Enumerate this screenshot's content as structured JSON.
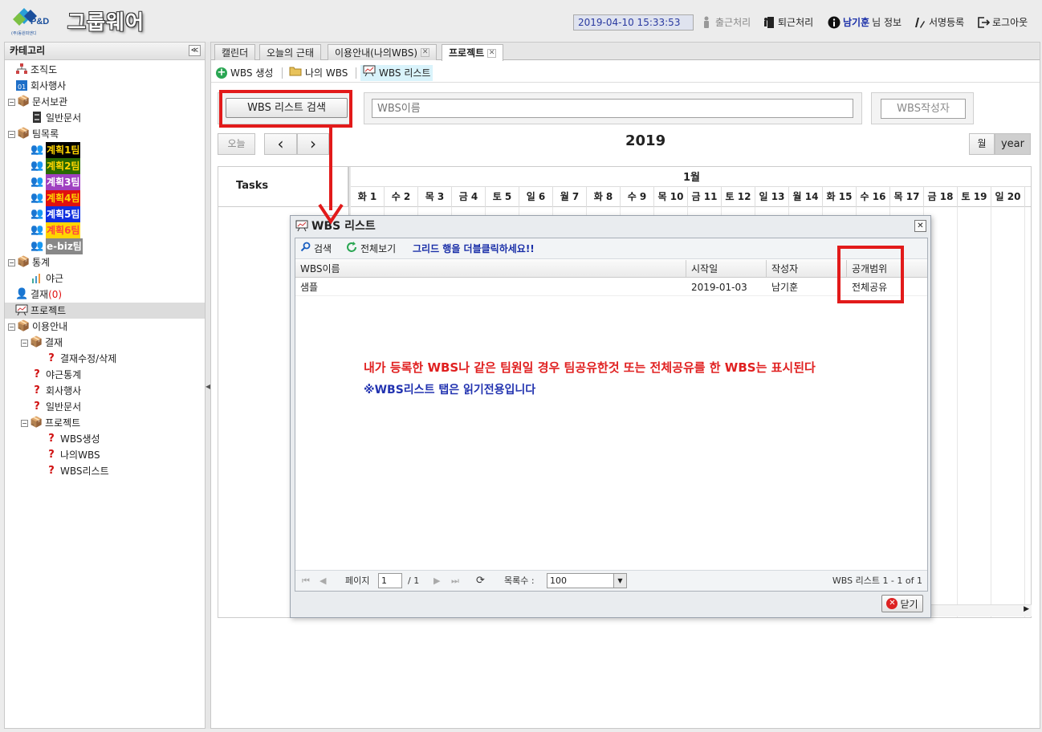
{
  "header": {
    "brand": "그룹웨어",
    "logo_text": "P&D",
    "logo_sub": "(주)동원피앤디",
    "datetime": "2019-04-10 15:33:53",
    "nav": [
      {
        "label": "출근처리",
        "icon": "person-icon"
      },
      {
        "label": "퇴근처리",
        "icon": "exit-door-icon"
      },
      {
        "label": "님 정보",
        "user": "남기훈",
        "icon": "info-icon"
      },
      {
        "label": "서명등록",
        "icon": "pen-icon"
      },
      {
        "label": "로그아웃",
        "icon": "logout-icon"
      }
    ]
  },
  "sidebar": {
    "title": "카테고리",
    "collapse": "≪",
    "items": [
      {
        "label": "조직도"
      },
      {
        "label": "회사행사"
      },
      {
        "label": "문서보관"
      },
      {
        "label": "일반문서"
      },
      {
        "label": "팀목록"
      },
      {
        "label": "계획1팀",
        "fg": "#ffd400",
        "bg": "#000000"
      },
      {
        "label": "계획2팀",
        "fg": "#ffd400",
        "bg": "#2a6a00"
      },
      {
        "label": "계획3팀",
        "fg": "#ffffff",
        "bg": "#a040c0"
      },
      {
        "label": "계획4팀",
        "fg": "#ffd400",
        "bg": "#e01010"
      },
      {
        "label": "계획5팀",
        "fg": "#ffffff",
        "bg": "#1030e0"
      },
      {
        "label": "계획6팀",
        "fg": "#ff4040",
        "bg": "#ffd400"
      },
      {
        "label": "e-biz팀",
        "fg": "#ffffff",
        "bg": "#888888"
      },
      {
        "label": "통계"
      },
      {
        "label": "야근"
      },
      {
        "label": "결재",
        "count": "(0)"
      },
      {
        "label": "프로젝트"
      },
      {
        "label": "이용안내"
      },
      {
        "label": "결재"
      },
      {
        "label": "결재수정/삭제"
      },
      {
        "label": "야근통계"
      },
      {
        "label": "회사행사"
      },
      {
        "label": "일반문서"
      },
      {
        "label": "프로젝트"
      },
      {
        "label": "WBS생성"
      },
      {
        "label": "나의WBS"
      },
      {
        "label": "WBS리스트"
      }
    ]
  },
  "tabs": [
    {
      "label": "캘린더"
    },
    {
      "label": "오늘의 근태"
    },
    {
      "label": "이용안내(나의WBS)",
      "close": "✕"
    },
    {
      "label": "프로젝트",
      "close": "✕"
    }
  ],
  "subtoolbar": {
    "create": "WBS 생성",
    "mine": "나의 WBS",
    "list": "WBS 리스트"
  },
  "search": {
    "button": "WBS 리스트 검색",
    "name_placeholder": "WBS이름",
    "writer": "WBS작성자"
  },
  "calendar": {
    "today": "오늘",
    "prev": "‹",
    "next": "›",
    "year": "2019",
    "month_view": "월",
    "year_view": "year",
    "tasks": "Tasks",
    "month": "1월",
    "days": [
      "화 1",
      "수 2",
      "목 3",
      "금 4",
      "토 5",
      "일 6",
      "월 7",
      "화 8",
      "수 9",
      "목 10",
      "금 11",
      "토 12",
      "일 13",
      "월 14",
      "화 15",
      "수 16",
      "목 17",
      "금 18",
      "토 19",
      "일 20"
    ]
  },
  "dialog": {
    "title": "WBS 리스트",
    "close_x": "✕",
    "search": "검색",
    "view_all": "전체보기",
    "hint": "그리드 행을 더블클릭하세요!!",
    "columns": [
      "WBS이름",
      "시작일",
      "작성자",
      "공개범위"
    ],
    "rows": [
      [
        "샘플",
        "2019-01-03",
        "남기훈",
        "전체공유"
      ]
    ],
    "note1": "내가 등록한 WBS나 같은 팀원일 경우 팀공유한것 또는 전체공유를 한 WBS는 표시된다",
    "note2": "※WBS리스트 탭은 읽기전용입니다",
    "pager": {
      "page_label": "페이지",
      "page": "1",
      "of": "/ 1",
      "rows_label": "목록수 :",
      "rows": "100",
      "summary": "WBS 리스트 1 - 1 of 1"
    },
    "close_button": "닫기"
  },
  "colors": {
    "annotation": "#e21a1a",
    "hint": "#1a2fa8",
    "note_red": "#e02020",
    "note_blue": "#2233b0"
  }
}
